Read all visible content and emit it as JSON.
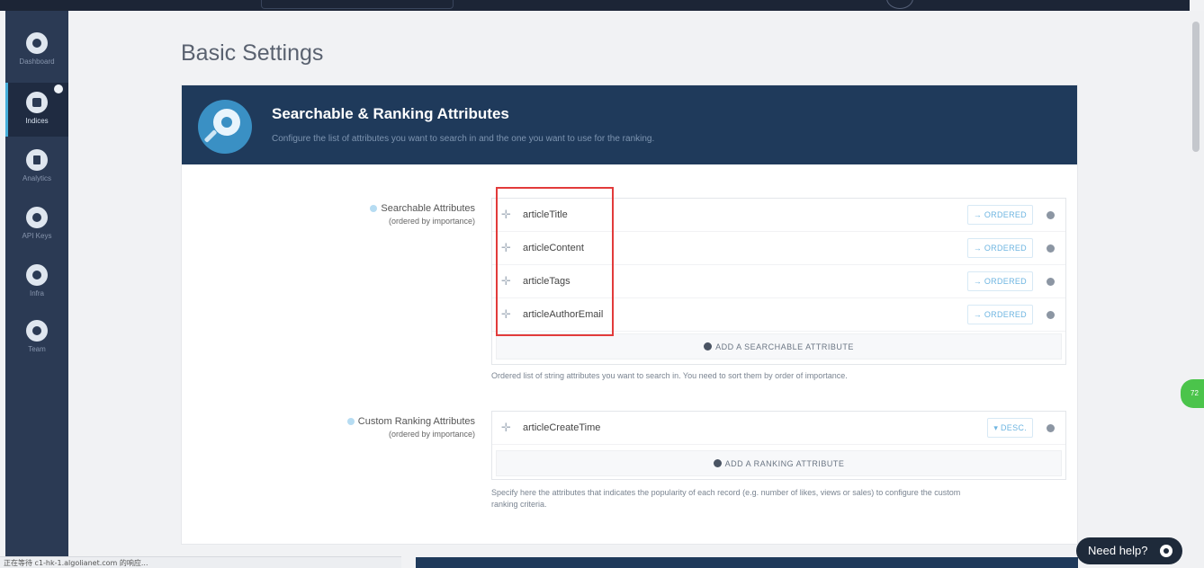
{
  "sidebar": {
    "items": [
      {
        "label": "Dashboard",
        "icon": "gauge-icon"
      },
      {
        "label": "Indices",
        "icon": "database-icon"
      },
      {
        "label": "Analytics",
        "icon": "bar-chart-icon"
      },
      {
        "label": "API Keys",
        "icon": "key-icon"
      },
      {
        "label": "Infra",
        "icon": "servers-icon"
      },
      {
        "label": "Team",
        "icon": "team-icon"
      }
    ]
  },
  "page": {
    "title": "Basic Settings"
  },
  "section": {
    "title": "Searchable & Ranking Attributes",
    "description": "Configure the list of attributes you want to search in and the one you want to use for the ranking."
  },
  "searchable": {
    "label": "Searchable Attributes",
    "sublabel": "(ordered by importance)",
    "attributes": [
      {
        "name": "articleTitle",
        "order": "→ ORDERED"
      },
      {
        "name": "articleContent",
        "order": "→ ORDERED"
      },
      {
        "name": "articleTags",
        "order": "→ ORDERED"
      },
      {
        "name": "articleAuthorEmail",
        "order": "→ ORDERED"
      }
    ],
    "add_label": "ADD A SEARCHABLE ATTRIBUTE",
    "help": "Ordered list of string attributes you want to search in. You need to sort them by order of importance."
  },
  "ranking": {
    "label": "Custom Ranking Attributes",
    "sublabel": "(ordered by importance)",
    "attributes": [
      {
        "name": "articleCreateTime",
        "order": "▾ DESC."
      }
    ],
    "add_label": "ADD A RANKING ATTRIBUTE",
    "help_line1": "Specify here the attributes that indicates the popularity of each record (e.g. number of likes, views or sales) to configure the custom",
    "help_line2": "ranking criteria."
  },
  "status_bar": {
    "text": "正在等待 c1-hk-1.algolianet.com 的响应..."
  },
  "help_button": {
    "label": "Need help?"
  },
  "floating_widget": {
    "text": "72"
  },
  "colors": {
    "sidebar": "#2b3a54",
    "header": "#1f3a5b",
    "accent": "#3a90c4",
    "highlight": "#e23b3b"
  }
}
